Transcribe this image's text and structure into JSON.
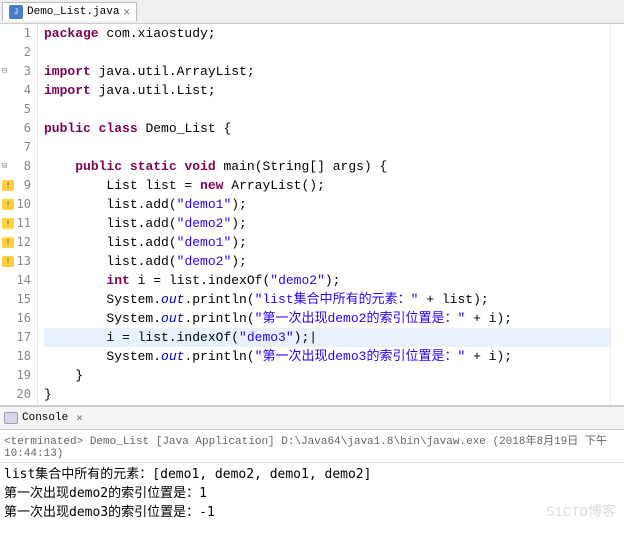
{
  "tab": {
    "filename": "Demo_List.java",
    "close": "✕"
  },
  "lines": [
    {
      "n": "1",
      "marker": "",
      "html": "<span class='kw'>package</span> <span class='plain'>com.xiaostudy;</span>"
    },
    {
      "n": "2",
      "marker": "",
      "html": ""
    },
    {
      "n": "3",
      "marker": "fold",
      "html": "<span class='kw'>import</span> <span class='plain'>java.util.ArrayList;</span>"
    },
    {
      "n": "4",
      "marker": "",
      "html": "<span class='kw'>import</span> <span class='plain'>java.util.List;</span>"
    },
    {
      "n": "5",
      "marker": "",
      "html": ""
    },
    {
      "n": "6",
      "marker": "",
      "html": "<span class='kw'>public</span> <span class='kw'>class</span> <span class='plain'>Demo_List {</span>"
    },
    {
      "n": "7",
      "marker": "",
      "html": ""
    },
    {
      "n": "8",
      "marker": "fold",
      "html": "    <span class='kw'>public</span> <span class='kw'>static</span> <span class='kw'>void</span> <span class='plain'>main(String[] args) {</span>"
    },
    {
      "n": "9",
      "marker": "warn",
      "html": "        <span class='plain'>List list = </span><span class='kw'>new</span> <span class='plain'>ArrayList();</span>"
    },
    {
      "n": "10",
      "marker": "warn",
      "html": "        <span class='plain'>list.add(</span><span class='str'>\"demo1\"</span><span class='plain'>);</span>"
    },
    {
      "n": "11",
      "marker": "warn",
      "html": "        <span class='plain'>list.add(</span><span class='str'>\"demo2\"</span><span class='plain'>);</span>"
    },
    {
      "n": "12",
      "marker": "warn",
      "html": "        <span class='plain'>list.add(</span><span class='str'>\"demo1\"</span><span class='plain'>);</span>"
    },
    {
      "n": "13",
      "marker": "warn",
      "html": "        <span class='plain'>list.add(</span><span class='str'>\"demo2\"</span><span class='plain'>);</span>"
    },
    {
      "n": "14",
      "marker": "",
      "html": "        <span class='kw'>int</span> <span class='plain'>i = list.indexOf(</span><span class='str'>\"demo2\"</span><span class='plain'>);</span>"
    },
    {
      "n": "15",
      "marker": "",
      "html": "        <span class='plain'>System.</span><span class='field'>out</span><span class='plain'>.println(</span><span class='str'>\"list集合中所有的元素：\"</span><span class='plain'> + list);</span>"
    },
    {
      "n": "16",
      "marker": "",
      "html": "        <span class='plain'>System.</span><span class='field'>out</span><span class='plain'>.println(</span><span class='str'>\"第一次出现demo2的索引位置是：\"</span><span class='plain'> + i);</span>"
    },
    {
      "n": "17",
      "marker": "",
      "hl": true,
      "html": "        <span class='plain'>i = list.indexOf(</span><span class='str'>\"demo3\"</span><span class='plain'>);|</span>"
    },
    {
      "n": "18",
      "marker": "",
      "html": "        <span class='plain'>System.</span><span class='field'>out</span><span class='plain'>.println(</span><span class='str'>\"第一次出现demo3的索引位置是：\"</span><span class='plain'> + i);</span>"
    },
    {
      "n": "19",
      "marker": "",
      "html": "    <span class='plain'>}</span>"
    },
    {
      "n": "20",
      "marker": "",
      "html": "<span class='plain'>}</span>"
    }
  ],
  "console": {
    "tab_label": "Console",
    "tab_close": "✕",
    "header": "<terminated> Demo_List [Java Application] D:\\Java64\\java1.8\\bin\\javaw.exe (2018年8月19日 下午10:44:13)",
    "output": [
      "list集合中所有的元素：[demo1, demo2, demo1, demo2]",
      "第一次出现demo2的索引位置是：1",
      "第一次出现demo3的索引位置是：-1"
    ]
  },
  "watermark": "51CTO博客"
}
